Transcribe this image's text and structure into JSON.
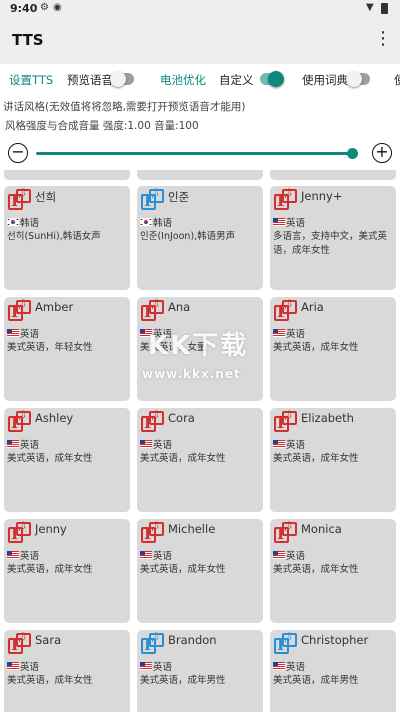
{
  "status_bar": {
    "time": "9:40",
    "icons": [
      "settings-gear-icon",
      "media-icon",
      "wifi-icon",
      "battery-icon"
    ]
  },
  "app_bar": {
    "title": "TTS",
    "menu_icon": "more-vert-icon",
    "menu_glyph": "⋮"
  },
  "tabs": [
    {
      "label": "设置TTS",
      "style": "green"
    },
    {
      "label": "预览语音",
      "toggle": "off"
    },
    {
      "label": "电池优化",
      "style": "green"
    },
    {
      "label": "自定义",
      "toggle": "on"
    },
    {
      "label": "使用词典",
      "toggle": "off"
    },
    {
      "label": "使"
    }
  ],
  "style_settings": {
    "line1": "讲话风格(无效值将将忽略,需要打开预览语音才能用)",
    "line2": "风格强度与合成音量  强度:1.00 音量:100",
    "minus_glyph": "−",
    "plus_glyph": "+",
    "slider_value_fraction": 0.98,
    "accent_color": "#0e8a7c"
  },
  "voices": [
    {
      "name": "선희",
      "language": "韩语",
      "flag": "kr",
      "icon_color": "red",
      "description": "선히(SunHi),韩语女声"
    },
    {
      "name": "인준",
      "language": "韩语",
      "flag": "kr",
      "icon_color": "blue",
      "description": "인준(InJoon),韩语男声"
    },
    {
      "name": "Jenny+",
      "language": "英语",
      "flag": "us",
      "icon_color": "red",
      "description": "多语言，支持中文，美式英语，成年女性"
    },
    {
      "name": "Amber",
      "language": "英语",
      "flag": "us",
      "icon_color": "red",
      "description": "美式英语，年轻女性"
    },
    {
      "name": "Ana",
      "language": "英语",
      "flag": "us",
      "icon_color": "red",
      "description": "美式英语，女童"
    },
    {
      "name": "Aria",
      "language": "英语",
      "flag": "us",
      "icon_color": "red",
      "description": "美式英语，成年女性"
    },
    {
      "name": "Ashley",
      "language": "英语",
      "flag": "us",
      "icon_color": "red",
      "description": "美式英语，成年女性"
    },
    {
      "name": "Cora",
      "language": "英语",
      "flag": "us",
      "icon_color": "red",
      "description": "美式英语，成年女性"
    },
    {
      "name": "Elizabeth",
      "language": "英语",
      "flag": "us",
      "icon_color": "red",
      "description": "美式英语，成年女性"
    },
    {
      "name": "Jenny",
      "language": "英语",
      "flag": "us",
      "icon_color": "red",
      "description": "美式英语，成年女性"
    },
    {
      "name": "Michelle",
      "language": "英语",
      "flag": "us",
      "icon_color": "red",
      "description": "美式英语，成年女性"
    },
    {
      "name": "Monica",
      "language": "英语",
      "flag": "us",
      "icon_color": "red",
      "description": "美式英语，成年女性"
    },
    {
      "name": "Sara",
      "language": "英语",
      "flag": "us",
      "icon_color": "red",
      "description": "美式英语，成年女性"
    },
    {
      "name": "Brandon",
      "language": "英语",
      "flag": "us",
      "icon_color": "blue",
      "description": "美式英语，成年男性"
    },
    {
      "name": "Christopher",
      "language": "英语",
      "flag": "us",
      "icon_color": "blue",
      "description": "美式英语，成年男性"
    }
  ],
  "partial_row_icons": [
    "red",
    "blue",
    "red"
  ],
  "watermark": {
    "logo": "KK下载",
    "url": "www.kkx.net"
  }
}
